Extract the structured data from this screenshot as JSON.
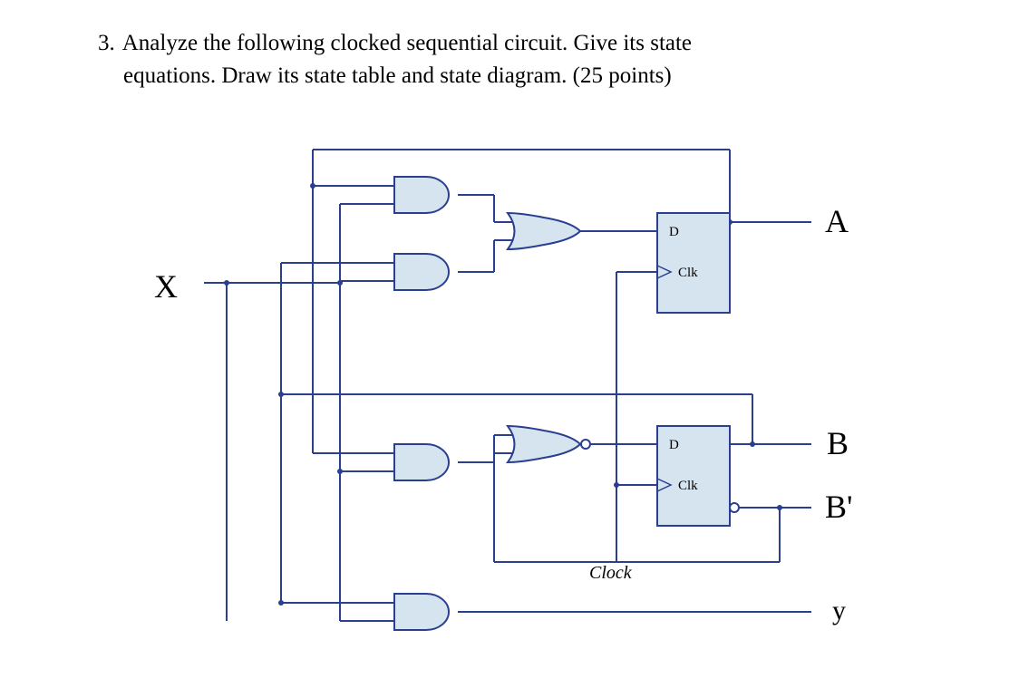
{
  "question": {
    "number": "3.",
    "text_line1": "Analyze  the  following  clocked  sequential  circuit.  Give  its  state",
    "text_line2": "equations. Draw its state table and state diagram. (25 points)"
  },
  "labels": {
    "input": "X",
    "output_A": "A",
    "output_B": "B",
    "output_Bnot": "B'",
    "output_y": "y",
    "clock": "Clock"
  },
  "flipflop": {
    "d": "D",
    "clk": "Clk"
  },
  "chart_data": {
    "type": "circuit-diagram",
    "inputs": [
      "X",
      "Clock"
    ],
    "outputs": [
      "A",
      "B",
      "B'",
      "y"
    ],
    "flipflops": [
      {
        "name": "A",
        "type": "D"
      },
      {
        "name": "B",
        "type": "D"
      }
    ],
    "gates": [
      {
        "id": "G1",
        "type": "AND",
        "inputs": [
          "A",
          "X"
        ]
      },
      {
        "id": "G2",
        "type": "AND",
        "inputs": [
          "B",
          "X"
        ]
      },
      {
        "id": "G3",
        "type": "OR",
        "inputs": [
          "G1",
          "G2"
        ],
        "output": "D_A"
      },
      {
        "id": "G4",
        "type": "AND",
        "inputs": [
          "A",
          "X"
        ]
      },
      {
        "id": "G5",
        "type": "NOR",
        "inputs": [
          "G4",
          "B'"
        ],
        "output": "D_B"
      },
      {
        "id": "G6",
        "type": "AND",
        "inputs": [
          "X",
          "B"
        ],
        "output": "y"
      }
    ],
    "equations": {
      "D_A": "A·X + B·X",
      "D_B": "(A·X + B')'",
      "y": "B·X"
    }
  }
}
